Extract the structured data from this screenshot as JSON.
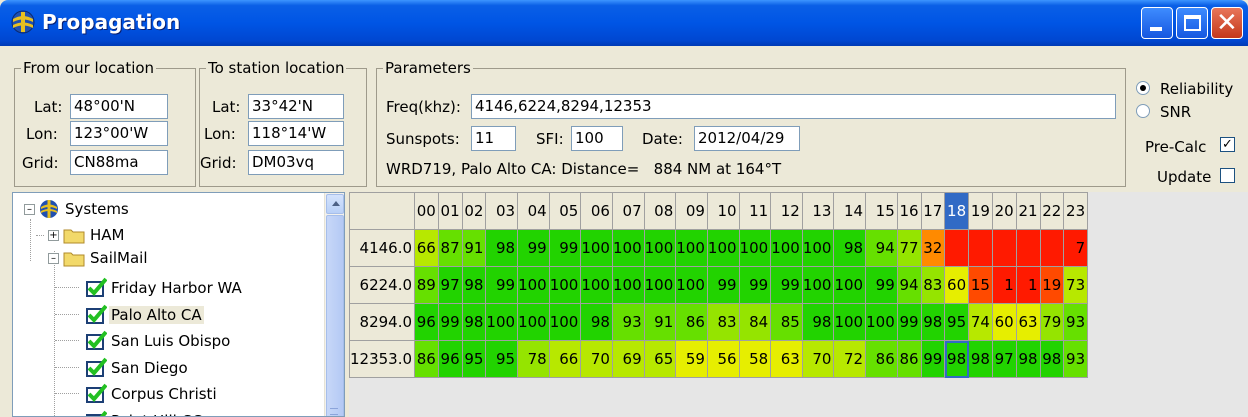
{
  "window": {
    "title": "Propagation"
  },
  "from": {
    "legend": "From our location",
    "lat_label": "Lat:",
    "lat": "48°00'N",
    "lon_label": "Lon:",
    "lon": "123°00'W",
    "grid_label": "Grid:",
    "grid": "CN88ma"
  },
  "to": {
    "legend": "To station location",
    "lat_label": "Lat:",
    "lat": "33°42'N",
    "lon_label": "Lon:",
    "lon": "118°14'W",
    "grid_label": "Grid:",
    "grid": "DM03vq"
  },
  "params": {
    "legend": "Parameters",
    "freq_label": "Freq(khz):",
    "freq": "4146,6224,8294,12353",
    "sunspots_label": "Sunspots:",
    "sunspots": "11",
    "sfi_label": "SFI:",
    "sfi": "100",
    "date_label": "Date:",
    "date": "2012/04/29",
    "summary": "WRD719, Palo Alto CA: Distance=   884 NM at 164°T"
  },
  "options": {
    "reliability_label": "Reliability",
    "snr_label": "SNR",
    "mode_selected": "Reliability",
    "precalc_label": "Pre-Calc",
    "precalc_checked": true,
    "update_label": "Update",
    "update_checked": false
  },
  "tree": {
    "root": "Systems",
    "ham": "HAM",
    "sailmail": "SailMail",
    "stations": [
      "Friday Harbor WA",
      "Palo Alto CA",
      "San Luis Obispo",
      "San Diego",
      "Corpus Christi",
      "Point Hill CC"
    ],
    "selected": "Palo Alto CA"
  },
  "grid": {
    "hours": [
      "00",
      "01",
      "02",
      "03",
      "04",
      "05",
      "06",
      "07",
      "08",
      "09",
      "10",
      "11",
      "12",
      "13",
      "14",
      "15",
      "16",
      "17",
      "18",
      "19",
      "20",
      "21",
      "22",
      "23"
    ],
    "selected_hour": "18",
    "rows": [
      {
        "freq": "4146.0",
        "values": [
          "66",
          "87",
          "91",
          "98",
          "99",
          "99",
          "100",
          "100",
          "100",
          "100",
          "100",
          "100",
          "100",
          "100",
          "98",
          "94",
          "77",
          "32",
          "",
          "",
          "",
          "",
          "",
          "7"
        ]
      },
      {
        "freq": "6224.0",
        "values": [
          "89",
          "97",
          "98",
          "99",
          "100",
          "100",
          "100",
          "100",
          "100",
          "100",
          "99",
          "99",
          "99",
          "100",
          "100",
          "99",
          "94",
          "83",
          "60",
          "15",
          "1",
          "1",
          "19",
          "73"
        ]
      },
      {
        "freq": "8294.0",
        "values": [
          "96",
          "99",
          "98",
          "100",
          "100",
          "100",
          "98",
          "93",
          "91",
          "86",
          "83",
          "84",
          "85",
          "98",
          "100",
          "100",
          "99",
          "98",
          "95",
          "74",
          "60",
          "63",
          "79",
          "93"
        ]
      },
      {
        "freq": "12353.0",
        "values": [
          "86",
          "96",
          "95",
          "95",
          "78",
          "66",
          "70",
          "69",
          "65",
          "59",
          "56",
          "58",
          "63",
          "70",
          "72",
          "86",
          "86",
          "99",
          "98",
          "98",
          "97",
          "98",
          "98",
          "93"
        ]
      }
    ]
  }
}
